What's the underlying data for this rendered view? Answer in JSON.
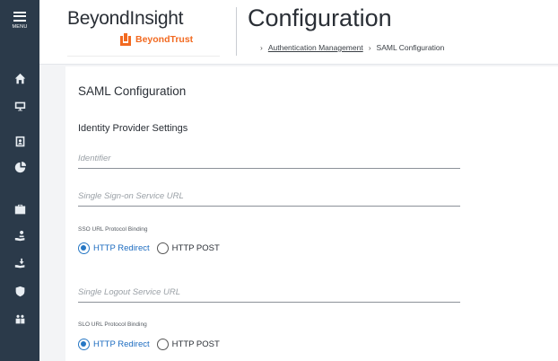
{
  "sidebar": {
    "menu_label": "MENU",
    "items": [
      {
        "icon": "home-icon"
      },
      {
        "icon": "monitor-icon"
      },
      {
        "icon": "id-card-icon"
      },
      {
        "icon": "chart-icon"
      },
      {
        "icon": "briefcase-icon"
      },
      {
        "icon": "user-hand-icon"
      },
      {
        "icon": "download-hand-icon"
      },
      {
        "icon": "shield-icon"
      },
      {
        "icon": "users-icon"
      }
    ]
  },
  "header": {
    "app_name": "BeyondInsight",
    "brand": "BeyondTrust",
    "brand_color": "#f26a21",
    "page_title": "Configuration",
    "breadcrumb": {
      "parent": "Authentication Management",
      "current": "SAML Configuration"
    }
  },
  "panel": {
    "title": "SAML Configuration",
    "section_title": "Identity Provider Settings",
    "identifier_placeholder": "Identifier",
    "sso_url_placeholder": "Single Sign-on Service URL",
    "sso_binding_label": "SSO URL Protocol Binding",
    "sso_binding_options": [
      "HTTP Redirect",
      "HTTP POST"
    ],
    "sso_binding_selected": "HTTP Redirect",
    "slo_url_placeholder": "Single Logout Service URL",
    "slo_binding_label": "SLO URL Protocol Binding",
    "slo_binding_options": [
      "HTTP Redirect",
      "HTTP POST"
    ],
    "slo_binding_selected": "HTTP Redirect"
  },
  "colors": {
    "sidebar_bg": "#2b3a4a",
    "accent": "#2677c4"
  }
}
